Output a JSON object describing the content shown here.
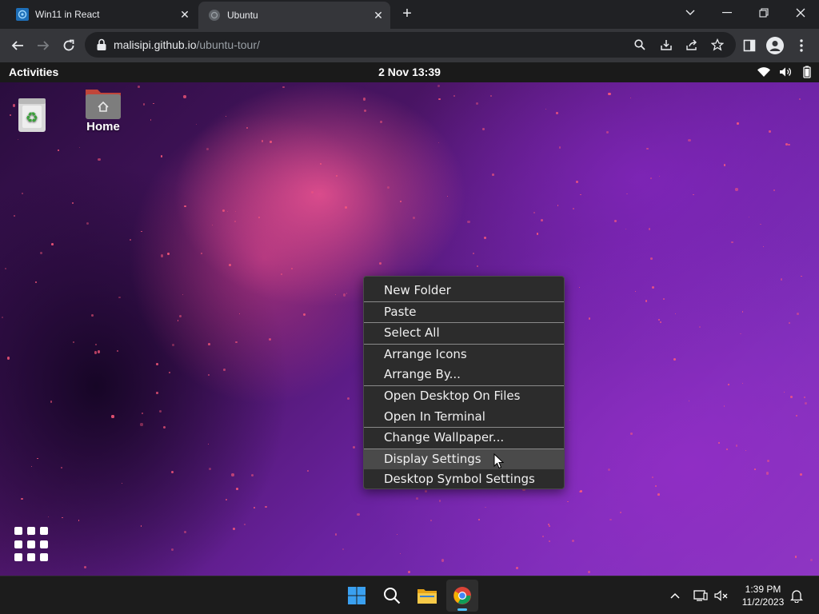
{
  "browser": {
    "tabs": [
      {
        "title": "Win11 in React",
        "close": "✕"
      },
      {
        "title": "Ubuntu",
        "close": "✕"
      }
    ],
    "new_tab": "+",
    "url_host": "malisipi.github.io",
    "url_path": "/ubuntu-tour/"
  },
  "ubuntu": {
    "activities": "Activities",
    "clock": "2 Nov 13:39",
    "desktop_icons": [
      {
        "label": ""
      },
      {
        "label": "Home"
      }
    ],
    "context_menu": {
      "items": [
        "New Folder",
        "Paste",
        "Select All",
        "Arrange Icons",
        "Arrange By...",
        "Open Desktop On Files",
        "Open In Terminal",
        "Change Wallpaper...",
        "Display Settings",
        "Desktop Symbol Settings"
      ],
      "hovered": "Display Settings"
    }
  },
  "taskbar": {
    "time": "1:39 PM",
    "date": "11/2/2023"
  },
  "colors": {
    "chrome_bg": "#202124",
    "toolbar_bg": "#35363a",
    "menu_bg": "#2c2c2c",
    "taskbar_bg": "#1c1c1c",
    "accent": "#4cc2ff"
  }
}
